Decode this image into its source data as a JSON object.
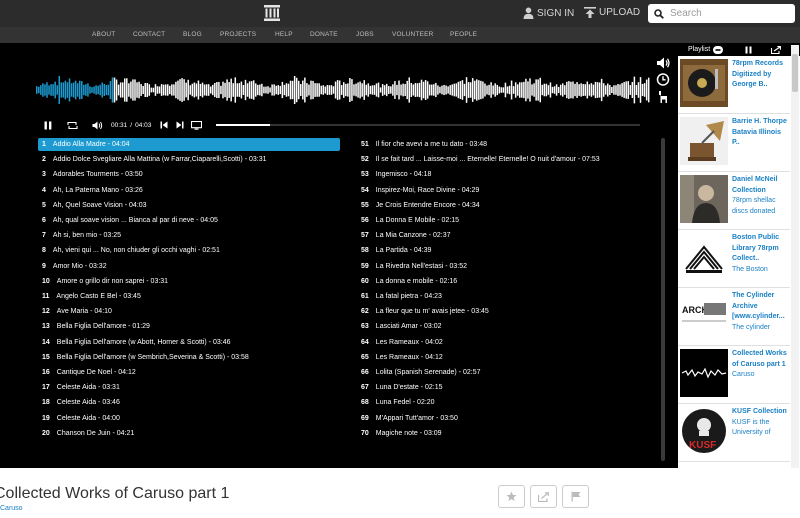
{
  "topbar": {
    "sign_in": "SIGN IN",
    "upload": "UPLOAD",
    "search_placeholder": "Search"
  },
  "nav": [
    "ABOUT",
    "CONTACT",
    "BLOG",
    "PROJECTS",
    "HELP",
    "DONATE",
    "JOBS",
    "VOLUNTEER",
    "PEOPLE"
  ],
  "player": {
    "current_time": "00:31",
    "duration": "04:03",
    "progress_fraction": 0.128,
    "tracks_left": [
      {
        "num": "1",
        "text": "Addio Alla Madre - 04:04"
      },
      {
        "num": "2",
        "text": "Addio Dolce Svegliare Alla Mattina (w Farrar,Ciaparelli,Scotti) - 03:31"
      },
      {
        "num": "3",
        "text": "Adorables Tourments - 03:50"
      },
      {
        "num": "4",
        "text": "Ah, La Paterna Mano - 03:26"
      },
      {
        "num": "5",
        "text": "Ah, Quel Soave Vision - 04:03"
      },
      {
        "num": "6",
        "text": "Ah, qual soave vision ... Bianca al par di neve - 04:05"
      },
      {
        "num": "7",
        "text": "Ah si, ben mio - 03:25"
      },
      {
        "num": "8",
        "text": "Ah, vieni qui ... No, non chiuder gli occhi vaghi - 02:51"
      },
      {
        "num": "9",
        "text": "Amor Mio - 03:32"
      },
      {
        "num": "10",
        "text": "Amore o grillo dir non saprei - 03:31"
      },
      {
        "num": "11",
        "text": "Angelo Casto E Bel - 03:45"
      },
      {
        "num": "12",
        "text": "Ave Maria - 04:10"
      },
      {
        "num": "13",
        "text": "Bella Figlia Dell'amore - 01:29"
      },
      {
        "num": "14",
        "text": "Bella Figlia Dell'amore (w Abott, Homer & Scotti) - 03:46"
      },
      {
        "num": "15",
        "text": "Bella Figlia Dell'amore (w Sembrich,Severina & Scotti) - 03:58"
      },
      {
        "num": "16",
        "text": "Cantique De Noel - 04:12"
      },
      {
        "num": "17",
        "text": "Celeste Aida - 03:31"
      },
      {
        "num": "18",
        "text": "Celeste Aida - 03:46"
      },
      {
        "num": "19",
        "text": "Celeste Aida - 04:00"
      },
      {
        "num": "20",
        "text": "Chanson De Juin - 04:21"
      }
    ],
    "tracks_right": [
      {
        "num": "51",
        "text": "Il fior che avevi a me tu dato - 03:48"
      },
      {
        "num": "52",
        "text": "Il se fait tard ... Laisse-moi ... Eternelle! Eternelle! O nuit d'amour - 07:53"
      },
      {
        "num": "53",
        "text": "Ingemisco - 04:18"
      },
      {
        "num": "54",
        "text": "Inspirez-Moi, Race Divine - 04:29"
      },
      {
        "num": "55",
        "text": "Je Crois Entendre Encore - 04:34"
      },
      {
        "num": "56",
        "text": "La Donna E Mobile - 02:15"
      },
      {
        "num": "57",
        "text": "La Mia Canzone - 02:37"
      },
      {
        "num": "58",
        "text": "La Partida - 04:39"
      },
      {
        "num": "59",
        "text": "La Rivedra Nell'estasi - 03:52"
      },
      {
        "num": "60",
        "text": "La donna e mobile - 02:16"
      },
      {
        "num": "61",
        "text": "La fatal pietra - 04:23"
      },
      {
        "num": "62",
        "text": "La fleur que tu m' avais jetee - 03:45"
      },
      {
        "num": "63",
        "text": "Lasciati Amar - 03:02"
      },
      {
        "num": "64",
        "text": "Les Rameaux - 04:02"
      },
      {
        "num": "65",
        "text": "Les Rameaux - 04:12"
      },
      {
        "num": "66",
        "text": "Lolita (Spanish Serenade) - 02:57"
      },
      {
        "num": "67",
        "text": "Luna D'estate - 02:15"
      },
      {
        "num": "68",
        "text": "Luna Fedel - 02:20"
      },
      {
        "num": "69",
        "text": "M'Appari Tutt'amor - 03:50"
      },
      {
        "num": "70",
        "text": "Magiche note - 03:09"
      }
    ]
  },
  "sidebar": {
    "header": "Playlist",
    "items": [
      {
        "title": "78rpm Records Digitized by George B..",
        "sub": ""
      },
      {
        "title": "Barrie H. Thorpe Batavia Illinois P..",
        "sub": ""
      },
      {
        "title": "Daniel McNeil Collection",
        "sub": "78rpm shellac discs donated"
      },
      {
        "title": "Boston Public Library 78rpm Collect..",
        "sub": "The Boston"
      },
      {
        "title": "The Cylinder Archive [www.cylinder...",
        "sub": "The cylinder"
      },
      {
        "title": "Collected Works of Caruso part 1",
        "sub": "Caruso"
      },
      {
        "title": "KUSF Collection",
        "sub": "KUSF is the University of"
      }
    ],
    "thumb_text": {
      "archive": "ARCHIVE",
      "kusf": "KUSF"
    }
  },
  "item": {
    "title": "Collected Works of Caruso part 1",
    "creator": "Caruso"
  },
  "colors": {
    "accent": "#1d9bd1",
    "link": "#1a80c5",
    "topbar": "#2c2c2c"
  }
}
